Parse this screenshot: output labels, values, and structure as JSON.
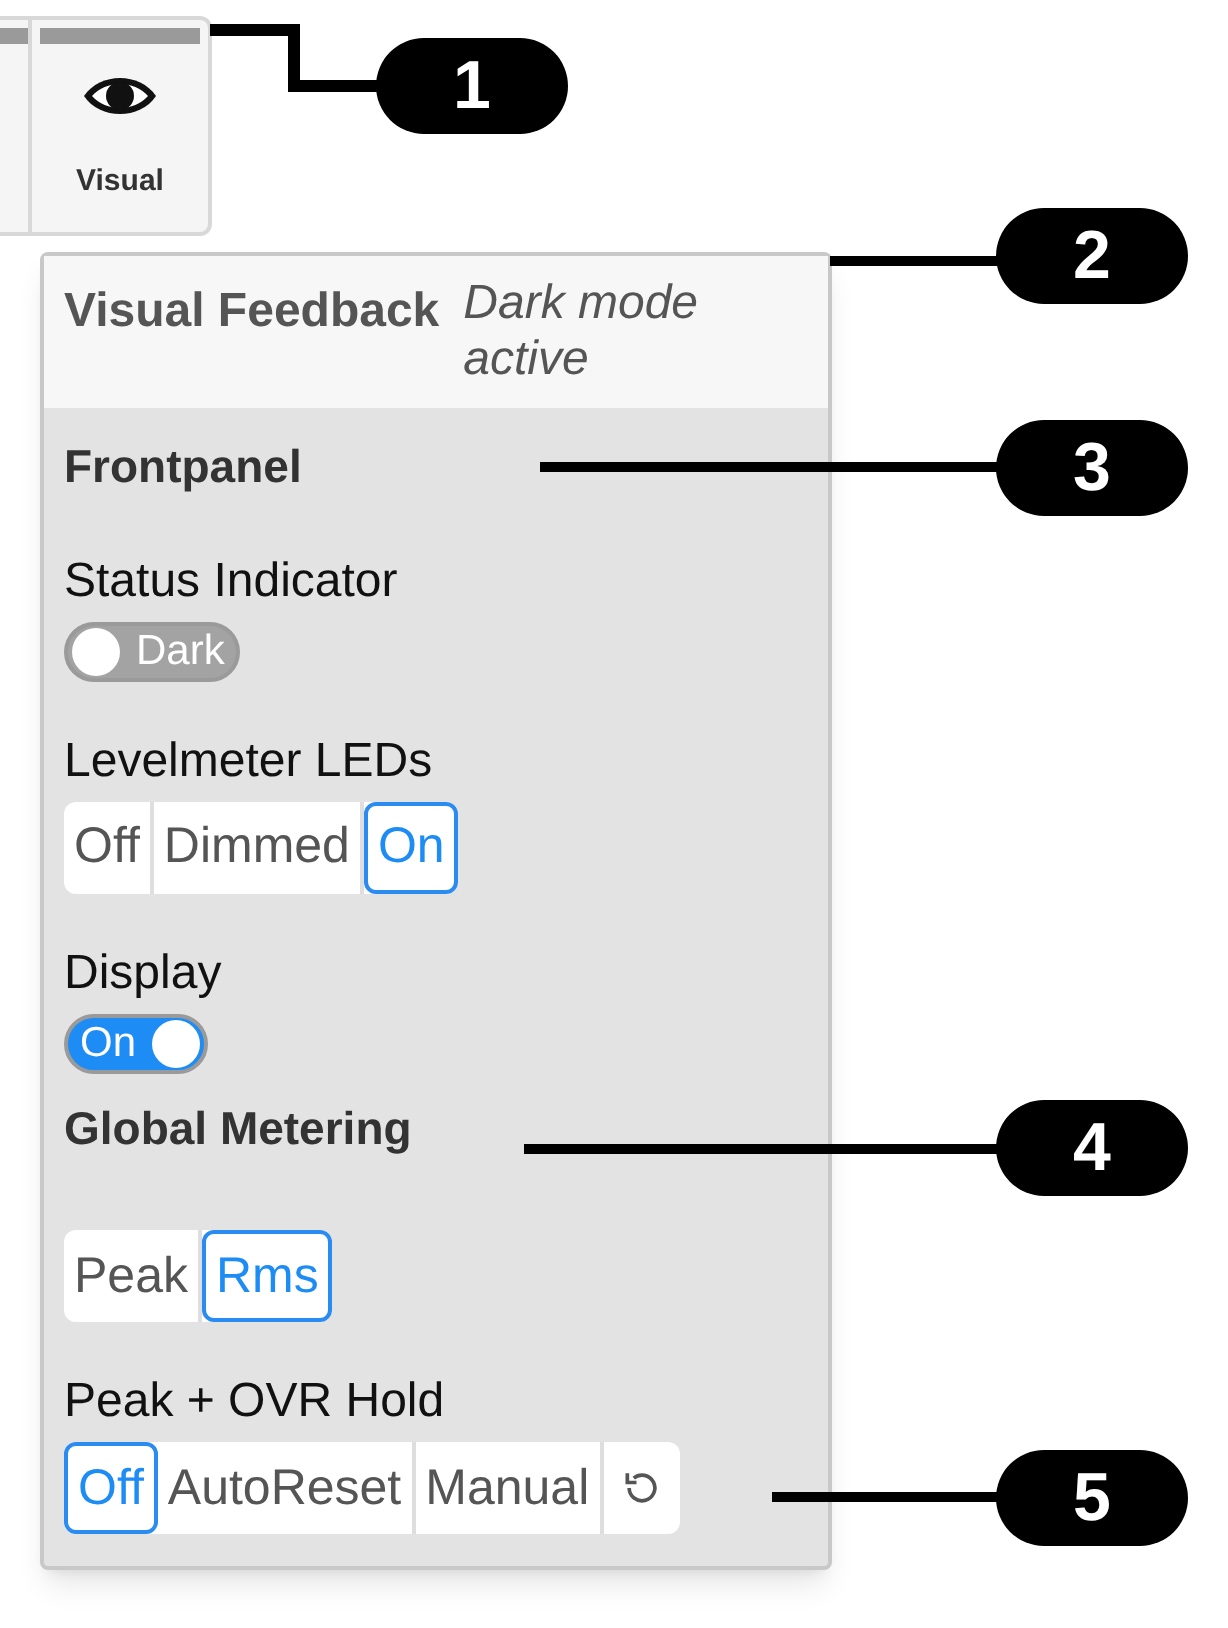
{
  "tab": {
    "label": "Visual",
    "selected": true
  },
  "panel": {
    "title": "Visual Feedback",
    "status": "Dark mode active"
  },
  "sections": [
    {
      "heading": "Frontpanel",
      "settings": [
        {
          "kind": "toggle",
          "label": "Status Indicator",
          "value": "Dark",
          "on": false
        },
        {
          "kind": "segmented",
          "label": "Levelmeter LEDs",
          "options": [
            {
              "label": "Off",
              "selected": false
            },
            {
              "label": "Dimmed",
              "selected": false
            },
            {
              "label": "On",
              "selected": true
            }
          ]
        },
        {
          "kind": "toggle",
          "label": "Display",
          "value": "On",
          "on": true
        }
      ]
    },
    {
      "heading": "Global Metering",
      "settings": [
        {
          "kind": "segmented",
          "options": [
            {
              "label": "Peak",
              "selected": false
            },
            {
              "label": "Rms",
              "selected": true
            }
          ]
        },
        {
          "kind": "segmented",
          "label": "Peak + OVR Hold",
          "options": [
            {
              "label": "Off",
              "selected": true
            },
            {
              "label": "AutoReset",
              "selected": false
            },
            {
              "label": "Manual",
              "selected": false
            }
          ],
          "reset": true
        }
      ]
    }
  ],
  "callouts": [
    "1",
    "2",
    "3",
    "4",
    "5"
  ]
}
